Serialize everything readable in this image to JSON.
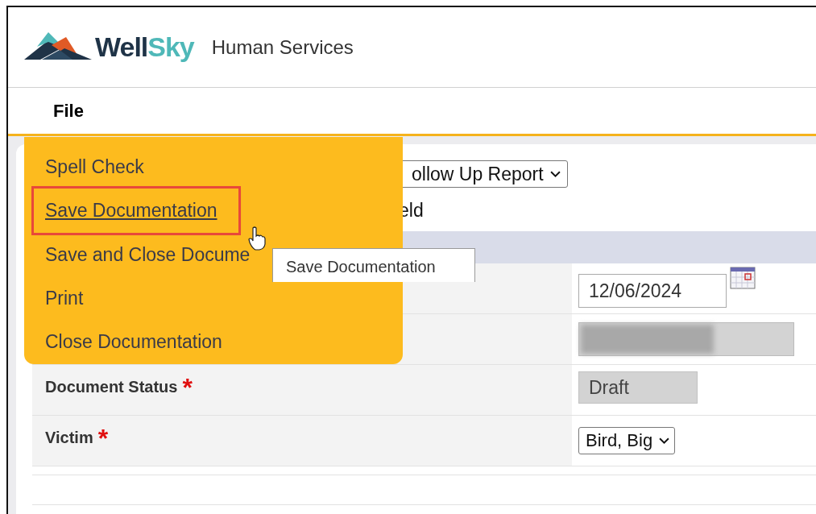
{
  "header": {
    "logo_parts": [
      "Well",
      "Sky"
    ],
    "product": "Human Services"
  },
  "menubar": {
    "items": [
      {
        "label": "File",
        "expanded": true
      }
    ]
  },
  "file_menu": {
    "items": [
      {
        "label": "Spell Check",
        "selected": false
      },
      {
        "label": "Save Documentation",
        "selected": true
      },
      {
        "label": "Save and Close Docume",
        "selected": false
      },
      {
        "label": "Print",
        "selected": false
      },
      {
        "label": "Close Documentation",
        "selected": false
      }
    ],
    "tooltip": "Save Documentation"
  },
  "form": {
    "report_select": "ollow Up Report",
    "section_label": "eld",
    "rows": [
      {
        "kind": "date",
        "value": "12/06/2024"
      },
      {
        "kind": "redacted"
      },
      {
        "label": "Document Status",
        "required_mark": "*",
        "kind": "readonly",
        "value": "Draft"
      },
      {
        "label": "Victim",
        "required_mark": "*",
        "kind": "select",
        "value": "Bird, Big"
      }
    ]
  }
}
